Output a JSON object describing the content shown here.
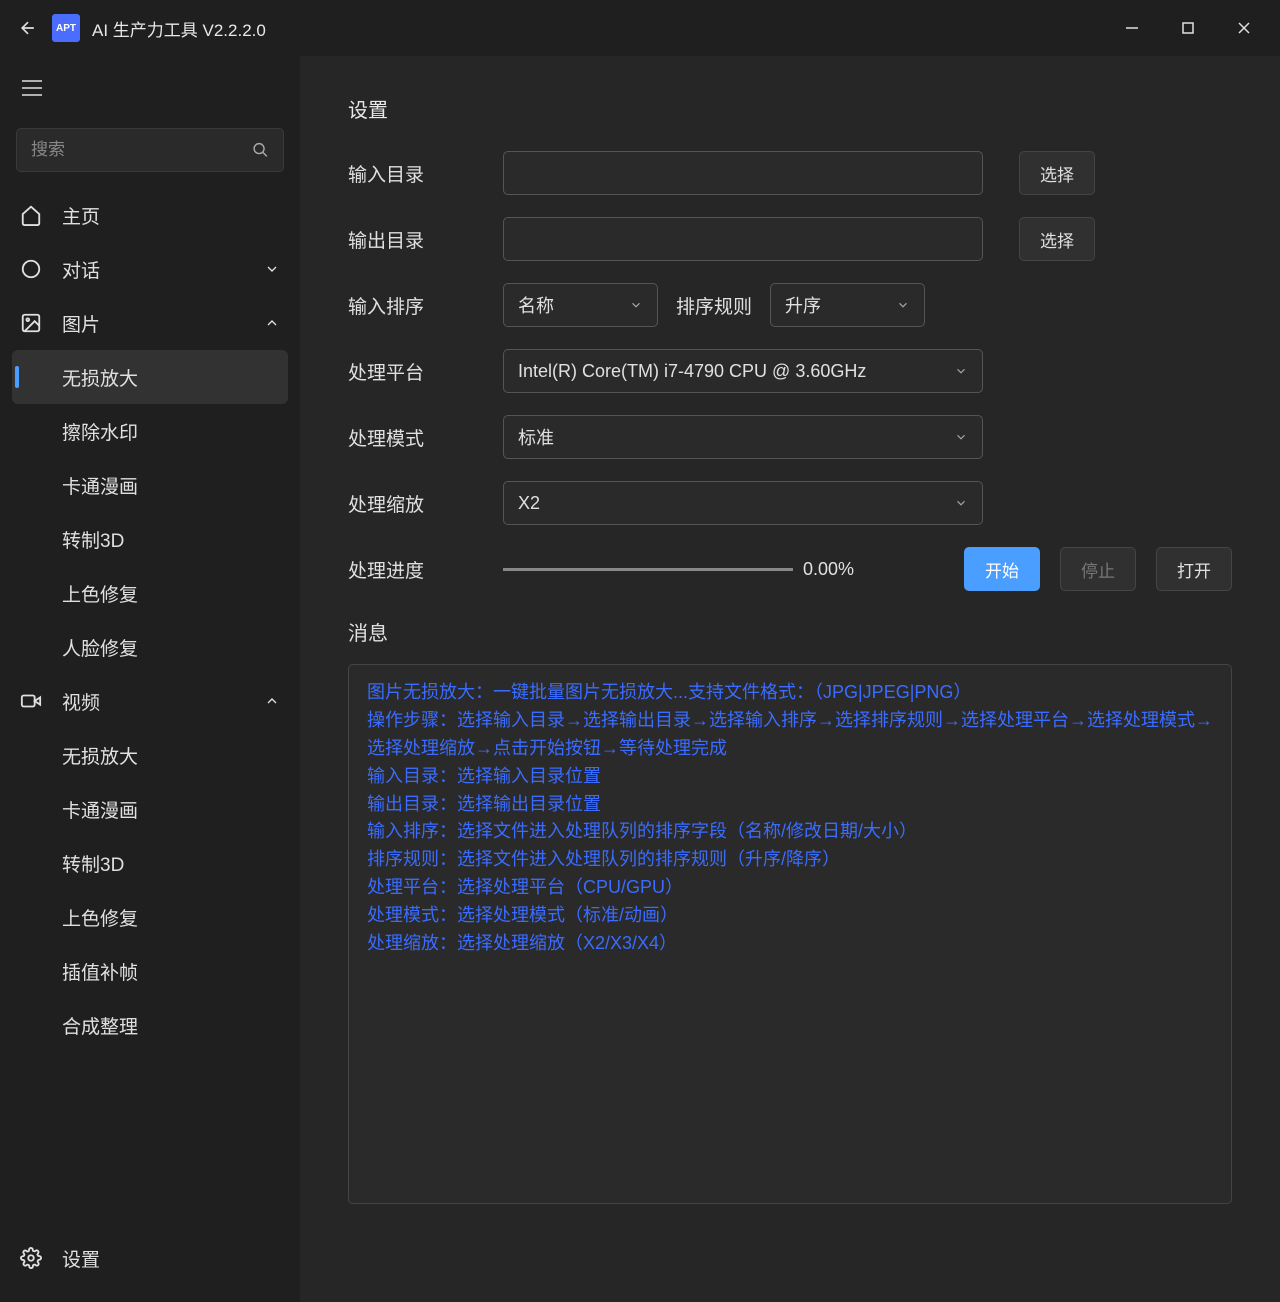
{
  "titlebar": {
    "app_badge": "APT",
    "title": "AI 生产力工具 V2.2.2.0"
  },
  "sidebar": {
    "search_placeholder": "搜索",
    "home": "主页",
    "dialog": "对话",
    "image": "图片",
    "image_items": {
      "upscale": "无损放大",
      "watermark": "擦除水印",
      "cartoon": "卡通漫画",
      "to3d": "转制3D",
      "colorize": "上色修复",
      "face": "人脸修复"
    },
    "video": "视频",
    "video_items": {
      "upscale": "无损放大",
      "cartoon": "卡通漫画",
      "to3d": "转制3D",
      "colorize": "上色修复",
      "interp": "插值补帧",
      "compose": "合成整理"
    },
    "settings": "设置"
  },
  "content": {
    "section_title": "设置",
    "labels": {
      "input_dir": "输入目录",
      "output_dir": "输出目录",
      "input_sort": "输入排序",
      "sort_rule": "排序规则",
      "platform": "处理平台",
      "mode": "处理模式",
      "scale": "处理缩放",
      "progress": "处理进度"
    },
    "values": {
      "input_dir": "",
      "output_dir": "",
      "input_sort": "名称",
      "sort_rule": "升序",
      "platform": "Intel(R) Core(TM) i7-4790 CPU @ 3.60GHz",
      "mode": "标准",
      "scale": "X2",
      "progress_text": "0.00%"
    },
    "buttons": {
      "choose": "选择",
      "start": "开始",
      "stop": "停止",
      "open": "打开"
    },
    "message_title": "消息",
    "message_text": "图片无损放大：一键批量图片无损放大...支持文件格式：（JPG|JPEG|PNG）\n操作步骤：选择输入目录→选择输出目录→选择输入排序→选择排序规则→选择处理平台→选择处理模式→选择处理缩放→点击开始按钮→等待处理完成\n输入目录：选择输入目录位置\n输出目录：选择输出目录位置\n输入排序：选择文件进入处理队列的排序字段（名称/修改日期/大小）\n排序规则：选择文件进入处理队列的排序规则（升序/降序）\n处理平台：选择处理平台（CPU/GPU）\n处理模式：选择处理模式（标准/动画）\n处理缩放：选择处理缩放（X2/X3/X4）"
  }
}
